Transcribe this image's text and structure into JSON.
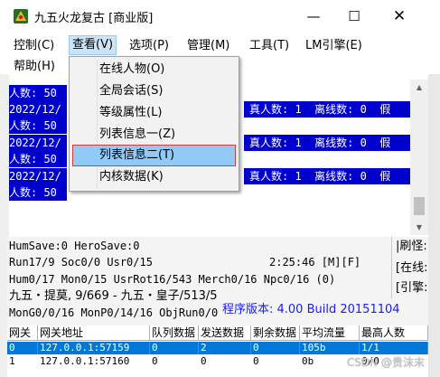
{
  "window": {
    "title": "九五火龙复古 [商业版]",
    "min_glyph": "—",
    "max_glyph": "☐",
    "close_glyph": "✕"
  },
  "menubar": {
    "items": [
      {
        "label": "控制(C)"
      },
      {
        "label": "查看(V)"
      },
      {
        "label": "选项(P)"
      },
      {
        "label": "管理(M)"
      },
      {
        "label": "工具(T)"
      },
      {
        "label": "LM引擎(E)"
      },
      {
        "label": "帮助(H)"
      }
    ]
  },
  "view_menu": {
    "items": [
      {
        "label": "在线人物(O)"
      },
      {
        "label": "全局会话(S)"
      },
      {
        "label": "等级属性(L)"
      },
      {
        "label": "列表信息一(Z)"
      },
      {
        "label": "列表信息二(T)"
      },
      {
        "label": "内核数据(K)"
      }
    ],
    "highlighted_index": 4
  },
  "log": {
    "lines": [
      {
        "left": "人数: 50",
        "right": ""
      },
      {
        "left": "2022/12/",
        "right": "真人数: 1  离线数: 0  假"
      },
      {
        "left": "人数: 50",
        "right": ""
      },
      {
        "left": "2022/12/",
        "right": "真人数: 1  离线数: 0  假"
      },
      {
        "left": "人数: 50",
        "right": ""
      },
      {
        "left": "2022/12/",
        "right": "真人数: 1  离线数: 0  假"
      },
      {
        "left": "人数: 50",
        "right": ""
      }
    ]
  },
  "status": {
    "line1": "HumSave:0 HeroSave:0",
    "line2_left": "Run17/9 Soc0/0 Usr0/15",
    "line2_time": "2:25:46 [M][F]",
    "line3": "Hum0/17 Mon0/15 UsrRot16/543 Merch0/16 Npc0/16 (0)",
    "line4": "九五・提莫, 9/669 - 九五・皇子/513/5",
    "line5": "MonG0/0/16 MonP0/14/16 ObjRun0/0",
    "version": "程序版本: 4.00 Build 20151104",
    "side": [
      "|刷怪:",
      "[在线:",
      "[引擎:"
    ]
  },
  "gateway_table": {
    "headers": [
      "网关",
      "网关地址",
      "队列数据",
      "发送数据",
      "剩余数据",
      "平均流量",
      "最高人数"
    ],
    "rows": [
      [
        "0",
        "127.0.0.1:57159",
        "0",
        "2",
        "0",
        "105b",
        "1/1"
      ],
      [
        "1",
        "127.0.0.1:57160",
        "0",
        "0",
        "0",
        "0b",
        "0/0"
      ]
    ]
  },
  "watermark": "CSDN @贵沫末",
  "colors": {
    "log_blue": "#0000cc",
    "selection_blue": "#0078d7",
    "menu_highlight": "#91c9f7",
    "highlight_border": "#d83b3b",
    "version_text": "#1a1aff"
  }
}
